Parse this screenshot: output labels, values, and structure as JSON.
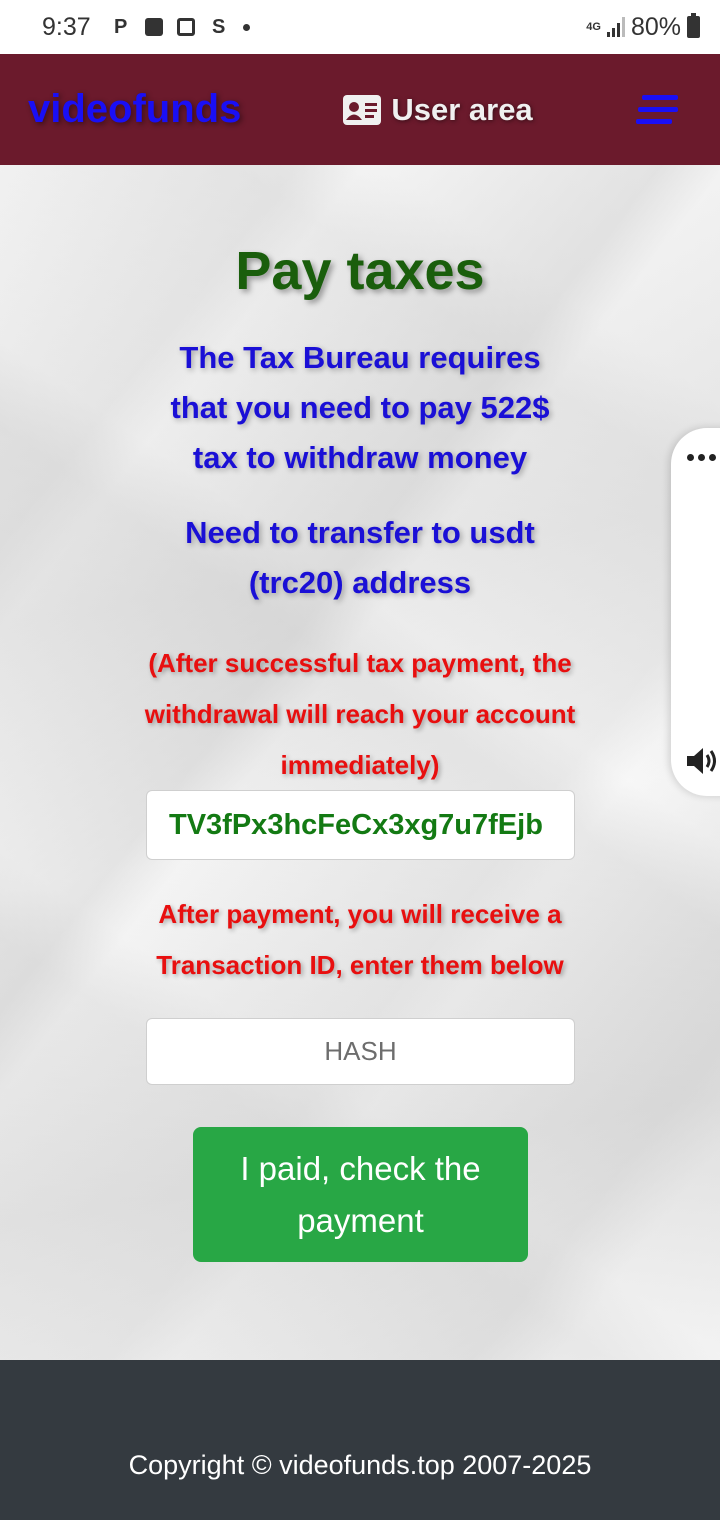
{
  "status_bar": {
    "time": "9:37",
    "notification_icons": [
      "p-icon",
      "check-icon",
      "camera-icon",
      "s-icon",
      "dot-icon"
    ],
    "network": "4G",
    "battery": "80%"
  },
  "navbar": {
    "brand": "videofunds",
    "user_area_label": "User area",
    "brand_color": "#1a0ff5",
    "background_color": "#6b1a2c"
  },
  "main": {
    "title": "Pay taxes",
    "tax_notice": "The Tax Bureau requires that you need to pay 522$ tax to withdraw money",
    "transfer_notice": "Need to transfer to usdt (trc20) address",
    "after_payment_notice": "(After successful tax payment, the withdrawal will reach your account immediately)",
    "address": "TV3fPx3hcFeCx3xg7u7fEjb",
    "transaction_instruction": "After payment, you will receive a Transaction ID, enter them below",
    "hash_placeholder": "HASH",
    "paid_button_label": "I paid, check the payment"
  },
  "footer": {
    "copyright": "Copyright © videofunds.top 2007-2025"
  }
}
